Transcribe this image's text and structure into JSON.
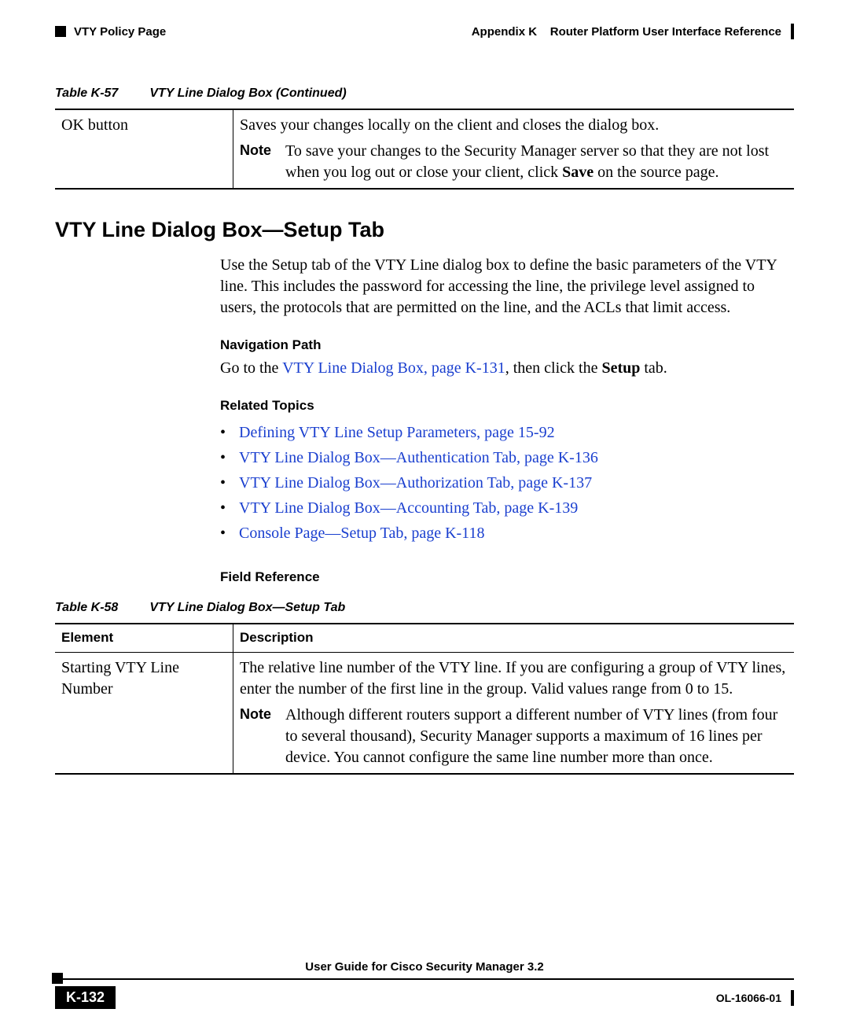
{
  "header": {
    "left": "VTY Policy Page",
    "right_prefix": "Appendix K",
    "right_title": "Router Platform User Interface Reference"
  },
  "table57": {
    "cap_num": "Table K-57",
    "cap_title": "VTY Line Dialog Box (Continued)",
    "row_label": "OK button",
    "row_desc": "Saves your changes locally on the client and closes the dialog box.",
    "note_label": "Note",
    "note_text_a": "To save your changes to the Security Manager server so that they are not lost when you log out or close your client, click ",
    "note_bold": "Save",
    "note_text_b": " on the source page."
  },
  "section": {
    "h2": "VTY Line Dialog Box—Setup Tab",
    "intro": "Use the Setup tab of the VTY Line dialog box to define the basic parameters of the VTY line. This includes the password for accessing the line, the privilege level assigned to users, the protocols that are permitted on the line, and the ACLs that limit access.",
    "nav_h": "Navigation Path",
    "nav_pre": "Go to the ",
    "nav_link": "VTY Line Dialog Box, page K-131",
    "nav_mid": ", then click the ",
    "nav_bold": "Setup",
    "nav_post": " tab.",
    "rel_h": "Related Topics",
    "links": [
      "Defining VTY Line Setup Parameters, page 15-92",
      "VTY Line Dialog Box—Authentication Tab, page K-136",
      "VTY Line Dialog Box—Authorization Tab, page K-137",
      "VTY Line Dialog Box—Accounting Tab, page K-139",
      "Console Page—Setup Tab, page K-118"
    ],
    "field_h": "Field Reference"
  },
  "table58": {
    "cap_num": "Table K-58",
    "cap_title": "VTY Line Dialog Box—Setup Tab",
    "col1": "Element",
    "col2": "Description",
    "row_label": "Starting VTY Line Number",
    "row_desc": "The relative line number of the VTY line. If you are configuring a group of VTY lines, enter the number of the first line in the group. Valid values range from 0 to 15.",
    "note_label": "Note",
    "note_text": "Although different routers support a different number of VTY lines (from four to several thousand), Security Manager supports a maximum of 16 lines per device. You cannot configure the same line number more than once."
  },
  "footer": {
    "guide": "User Guide for Cisco Security Manager 3.2",
    "page": "K-132",
    "ol": "OL-16066-01"
  }
}
